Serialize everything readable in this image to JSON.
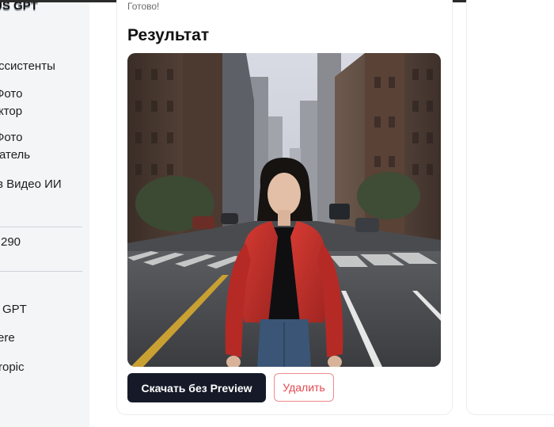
{
  "sidebar": {
    "brand": "US GPT",
    "items": [
      {
        "label": "Ассистенты"
      },
      {
        "label": "Фото"
      },
      {
        "label": "ктор"
      },
      {
        "label": "Фото"
      },
      {
        "label": "атель"
      },
      {
        "label": "в Видео ИИ"
      },
      {
        "label": "290"
      },
      {
        "label": "GPT"
      },
      {
        "label": "ere"
      },
      {
        "label": "ropic"
      }
    ]
  },
  "result": {
    "status": "Готово!",
    "title": "Результат",
    "download_label": "Скачать без Preview",
    "delete_label": "Удалить"
  },
  "colors": {
    "download_bg": "#161a28",
    "delete_text": "#e5484d",
    "jacket": "#c7312c"
  }
}
